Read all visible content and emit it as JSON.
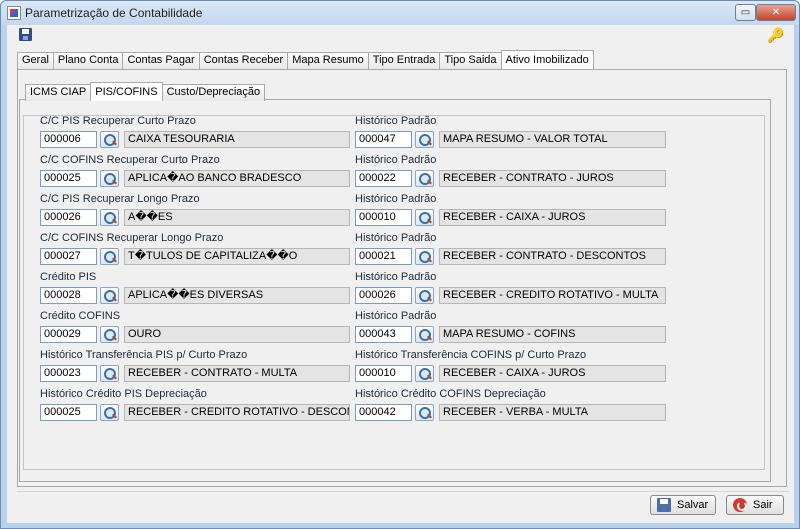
{
  "window": {
    "title": "Parametrização de Contabilidade",
    "min_glyph": "▭",
    "close_glyph": "✕"
  },
  "main_tabs": [
    "Geral",
    "Plano Conta",
    "Contas Pagar",
    "Contas Receber",
    "Mapa Resumo",
    "Tipo Entrada",
    "Tipo Saida",
    "Ativo Imobilizado"
  ],
  "main_tabs_active": "Ativo Imobilizado",
  "sub_tabs": [
    "ICMS CIAP",
    "PIS/COFINS",
    "Custo/Depreciação"
  ],
  "sub_tabs_active": "PIS/COFINS",
  "rows": [
    {
      "left_label": "C/C PIS Recuperar Curto Prazo",
      "left_code": "000006",
      "left_desc": "CAIXA TESOURARIA",
      "right_label": "Histórico Padrão",
      "right_code": "000047",
      "right_desc": "MAPA RESUMO - VALOR TOTAL"
    },
    {
      "left_label": "C/C COFINS Recuperar Curto Prazo",
      "left_code": "000025",
      "left_desc": "APLICA�AO BANCO BRADESCO",
      "right_label": "Histórico Padrão",
      "right_code": "000022",
      "right_desc": "RECEBER - CONTRATO - JUROS"
    },
    {
      "left_label": "C/C PIS Recuperar Longo Prazo",
      "left_code": "000026",
      "left_desc": "A��ES",
      "right_label": "Histórico Padrão",
      "right_code": "000010",
      "right_desc": "RECEBER - CAIXA - JUROS"
    },
    {
      "left_label": "C/C COFINS Recuperar Longo Prazo",
      "left_code": "000027",
      "left_desc": "T�TULOS DE CAPITALIZA��O",
      "right_label": "Histórico Padrão",
      "right_code": "000021",
      "right_desc": "RECEBER - CONTRATO - DESCONTOS"
    },
    {
      "left_label": "Crédito PIS",
      "left_code": "000028",
      "left_desc": "APLICA��ES DIVERSAS",
      "right_label": "Histórico Padrão",
      "right_code": "000026",
      "right_desc": "RECEBER - CREDITO ROTATIVO - MULTA"
    },
    {
      "left_label": "Crédito COFINS",
      "left_code": "000029",
      "left_desc": "OURO",
      "right_label": "Histórico Padrão",
      "right_code": "000043",
      "right_desc": "MAPA RESUMO - COFINS"
    },
    {
      "left_label": "Histórico Transferência PIS p/ Curto Prazo",
      "left_code": "000023",
      "left_desc": "RECEBER - CONTRATO - MULTA",
      "right_label": "Histórico Transferência COFINS p/ Curto Prazo",
      "right_code": "000010",
      "right_desc": "RECEBER - CAIXA - JUROS"
    },
    {
      "left_label": "Histórico Crédito PIS Depreciação",
      "left_code": "000025",
      "left_desc": "RECEBER - CREDITO ROTATIVO - DESCONTOS",
      "right_label": "Histórico Crédito COFINS Depreciação",
      "right_code": "000042",
      "right_desc": "RECEBER - VERBA - MULTA"
    }
  ],
  "footer": {
    "save_label": "Salvar",
    "exit_label": "Sair"
  },
  "icons": {
    "save": "save-icon",
    "key": "key-icon",
    "search": "search-icon",
    "exit": "exit-icon"
  },
  "colors": {
    "title_bar": "#c3d7ee",
    "panel": "#f0f0f0",
    "close_button": "#c3432c"
  }
}
